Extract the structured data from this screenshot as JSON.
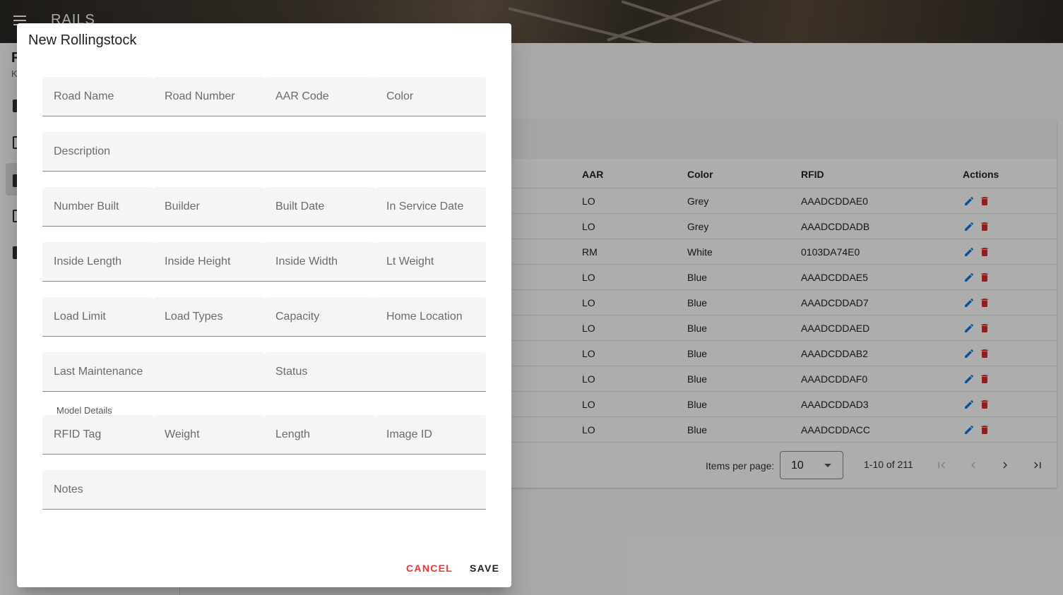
{
  "app": {
    "title": "RAILS"
  },
  "sidebar": {
    "title": "R",
    "subtitle": "K"
  },
  "table": {
    "columns": [
      "AAR",
      "Color",
      "RFID",
      "Actions"
    ],
    "rows": [
      {
        "aar": "LO",
        "color": "Grey",
        "rfid": "AAADCDDAE0"
      },
      {
        "aar": "LO",
        "color": "Grey",
        "rfid": "AAADCDDADB"
      },
      {
        "aar": "RM",
        "color": "White",
        "rfid": "0103DA74E0"
      },
      {
        "aar": "LO",
        "color": "Blue",
        "rfid": "AAADCDDAE5"
      },
      {
        "aar": "LO",
        "color": "Blue",
        "rfid": "AAADCDDAD7"
      },
      {
        "aar": "LO",
        "color": "Blue",
        "rfid": "AAADCDDAED"
      },
      {
        "aar": "LO",
        "color": "Blue",
        "rfid": "AAADCDDAB2"
      },
      {
        "aar": "LO",
        "color": "Blue",
        "rfid": "AAADCDDAF0"
      },
      {
        "aar": "LO",
        "color": "Blue",
        "rfid": "AAADCDDAD3"
      },
      {
        "aar": "LO",
        "color": "Blue",
        "rfid": "AAADCDDACC"
      }
    ],
    "edit_icon": "pencil-icon",
    "delete_icon": "trash-icon",
    "edit_color": "#1976d2",
    "delete_color": "#d32f2f"
  },
  "paginator": {
    "items_per_page_label": "Items per page:",
    "items_per_page": "10",
    "range": "1-10 of 211"
  },
  "dialog": {
    "title": "New Rollingstock",
    "fields": {
      "road_name": "Road Name",
      "road_number": "Road Number",
      "aar_code": "AAR Code",
      "color": "Color",
      "description": "Description",
      "number_built": "Number Built",
      "builder": "Builder",
      "built_date": "Built Date",
      "in_service_date": "In Service Date",
      "inside_length": "Inside Length",
      "inside_height": "Inside Height",
      "inside_width": "Inside Width",
      "lt_weight": "Lt Weight",
      "load_limit": "Load Limit",
      "load_types": "Load Types",
      "capacity": "Capacity",
      "home_location": "Home Location",
      "last_maintenance": "Last Maintenance",
      "status": "Status",
      "rfid_tag": "RFID Tag",
      "weight": "Weight",
      "length": "Length",
      "image_id": "Image ID",
      "notes": "Notes"
    },
    "section_model_details": "Model Details",
    "cancel_label": "CANCEL",
    "save_label": "SAVE",
    "cancel_color": "#e53935"
  }
}
